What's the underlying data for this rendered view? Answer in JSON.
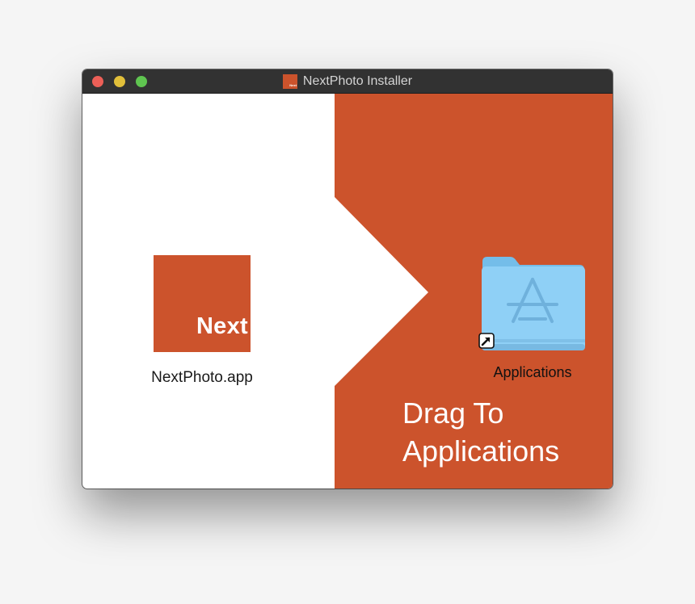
{
  "colors": {
    "brand_orange": "#cc532c",
    "titlebar": "#323232",
    "close": "#ec5f57",
    "minimize": "#e1bf3a",
    "zoom": "#5fc550",
    "folder_blue": "#8ccdf4"
  },
  "window": {
    "title": "NextPhoto Installer",
    "title_icon": "nextphoto-app-icon",
    "title_icon_text": "Next",
    "controls": [
      "close",
      "minimize",
      "zoom"
    ]
  },
  "left_panel": {
    "app_icon": "nextphoto-app-icon",
    "app_icon_text": "Next",
    "app_label": "NextPhoto.app"
  },
  "right_panel": {
    "folder_icon": "applications-folder-icon",
    "alias_badge": "alias-arrow-icon",
    "folder_label": "Applications",
    "instruction_line1": "Drag To",
    "instruction_line2": "Applications"
  }
}
